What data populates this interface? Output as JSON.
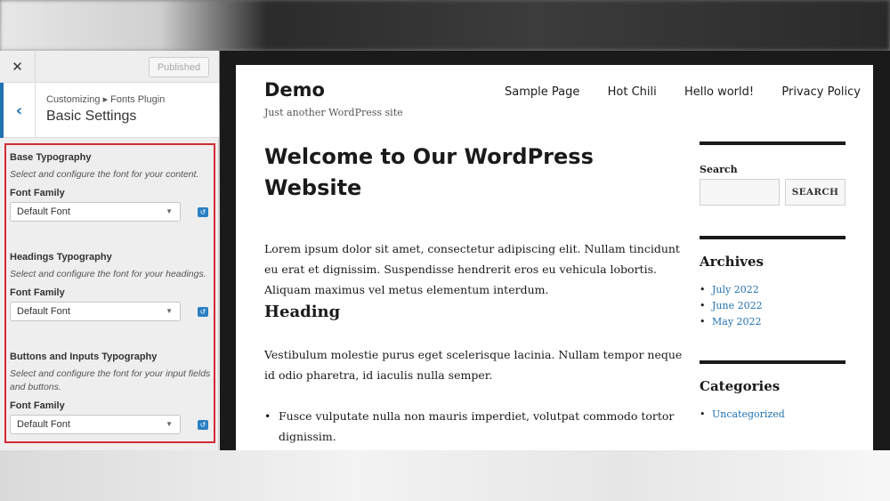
{
  "customizer": {
    "close_label": "✕",
    "published_label": "Published",
    "back_label": "‹",
    "breadcrumb": "Customizing ▸ Fonts Plugin",
    "section_title": "Basic Settings",
    "groups": [
      {
        "title": "Base Typography",
        "description": "Select and configure the font for your content.",
        "label": "Font Family",
        "value": "Default Font"
      },
      {
        "title": "Headings Typography",
        "description": "Select and configure the font for your headings.",
        "label": "Font Family",
        "value": "Default Font"
      },
      {
        "title": "Buttons and Inputs Typography",
        "description": "Select and configure the font for your input fields and buttons.",
        "label": "Font Family",
        "value": "Default Font"
      }
    ],
    "select_arrow": "▼",
    "reset_glyph": "↺"
  },
  "site": {
    "title": "Demo",
    "tagline": "Just another WordPress site",
    "nav": [
      "Sample Page",
      "Hot Chili",
      "Hello world!",
      "Privacy Policy"
    ],
    "post_title": "Welcome to Our WordPress Website",
    "paragraph1": "Lorem ipsum dolor sit amet, consectetur adipiscing elit. Nullam tincidunt eu erat et dignissim. Suspendisse hendrerit eros eu vehicula lobortis. Aliquam maximus vel metus elementum interdum.",
    "heading": "Heading",
    "paragraph2": "Vestibulum molestie purus eget scelerisque lacinia. Nullam tempor neque id odio pharetra, id iaculis nulla semper.",
    "bullets": [
      "Fusce vulputate nulla non mauris imperdiet, volutpat commodo tortor dignissim."
    ],
    "sidebar": {
      "search_title": "Search",
      "search_button": "SEARCH",
      "archives_title": "Archives",
      "archives": [
        "July 2022",
        "June 2022",
        "May 2022"
      ],
      "categories_title": "Categories",
      "categories": [
        "Uncategorized"
      ]
    }
  },
  "colors": {
    "accent": "#2271b1",
    "highlight_border": "#d42a35"
  }
}
